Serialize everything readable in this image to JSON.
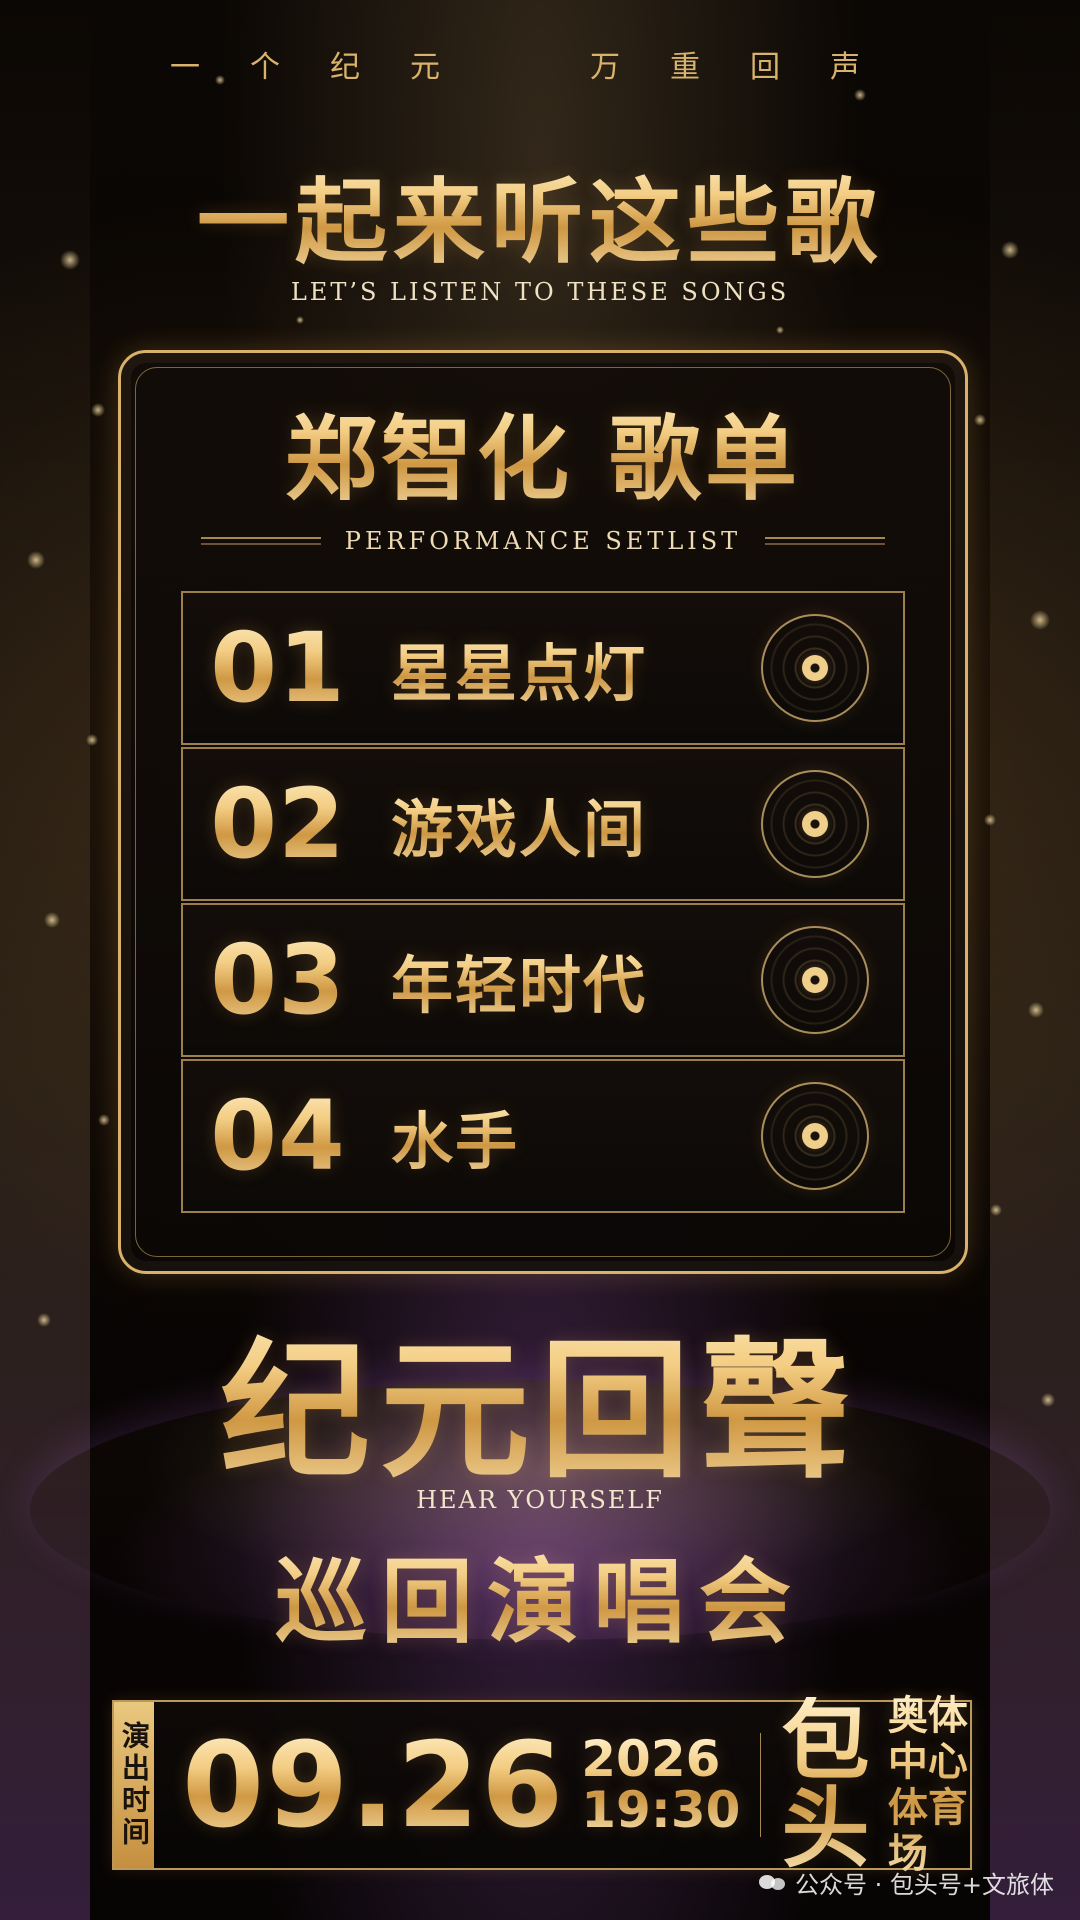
{
  "tagline": {
    "left": "一个纪元",
    "right": "万重回声"
  },
  "hero": {
    "title": "一起来听这些歌",
    "subtitle": "LET’S LISTEN TO THESE SONGS"
  },
  "setlist_card": {
    "title": "郑智化  歌单",
    "subtitle": "PERFORMANCE SETLIST",
    "songs": [
      {
        "no": "01",
        "title": "星星点灯"
      },
      {
        "no": "02",
        "title": "游戏人间"
      },
      {
        "no": "03",
        "title": "年轻时代"
      },
      {
        "no": "04",
        "title": "水手"
      }
    ],
    "disc_icon": "vinyl-record-icon"
  },
  "brand": {
    "logo": "纪元回聲",
    "logo_subtitle": "HEAR YOURSELF",
    "tour_title": "巡回演唱会"
  },
  "event": {
    "label": "演出时间",
    "date": "09.26",
    "year": "2026",
    "time": "19:30",
    "city": "包头",
    "venue_line1": "奥体中心",
    "venue_line2": "体育场"
  },
  "watermark": {
    "icon": "wechat-icon",
    "text": "公众号 · 包头号+文旅体"
  }
}
